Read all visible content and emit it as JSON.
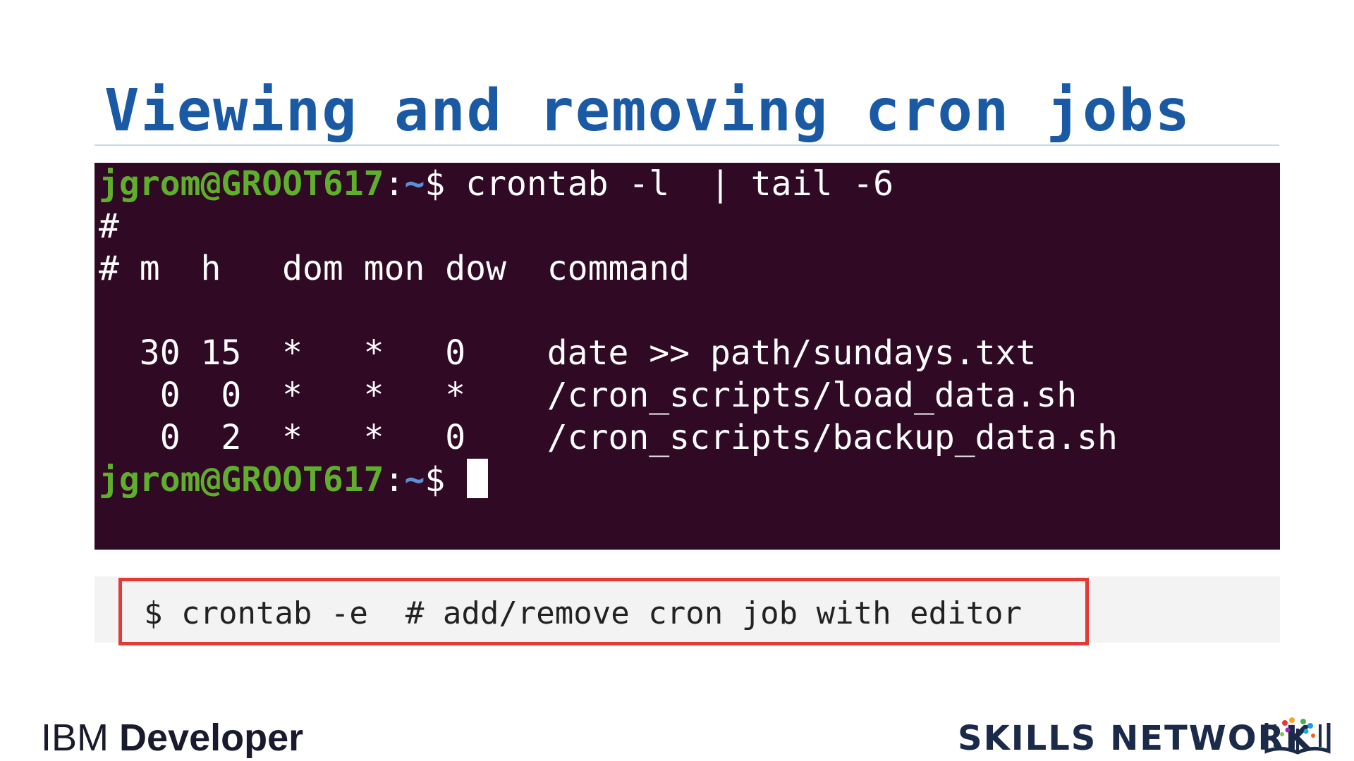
{
  "slide": {
    "title": "Viewing and removing cron jobs"
  },
  "terminal": {
    "prompt_user": "jgrom@GROOT617",
    "prompt_sep": ":",
    "prompt_path": "~",
    "prompt_dollar": "$",
    "command": " crontab -l  | tail -6",
    "lines": [
      "#",
      "# m  h   dom mon dow  command",
      "",
      "  30 15  *   *   0    date >> path/sundays.txt",
      "   0  0  *   *   *    /cron_scripts/load_data.sh",
      "   0  2  *   *   0    /cron_scripts/backup_data.sh"
    ]
  },
  "command_box": {
    "text": "$ crontab -e  # add/remove cron job with editor"
  },
  "branding": {
    "ibm_prefix": "IBM",
    "ibm_suffix": "Developer",
    "skills_network": "SKILLS NETWORK"
  },
  "colors": {
    "title": "#1a5aa5",
    "terminal_bg": "#300a24",
    "prompt_user": "#5faf2d",
    "prompt_path": "#5b8fd6",
    "highlight_border": "#e53935"
  }
}
